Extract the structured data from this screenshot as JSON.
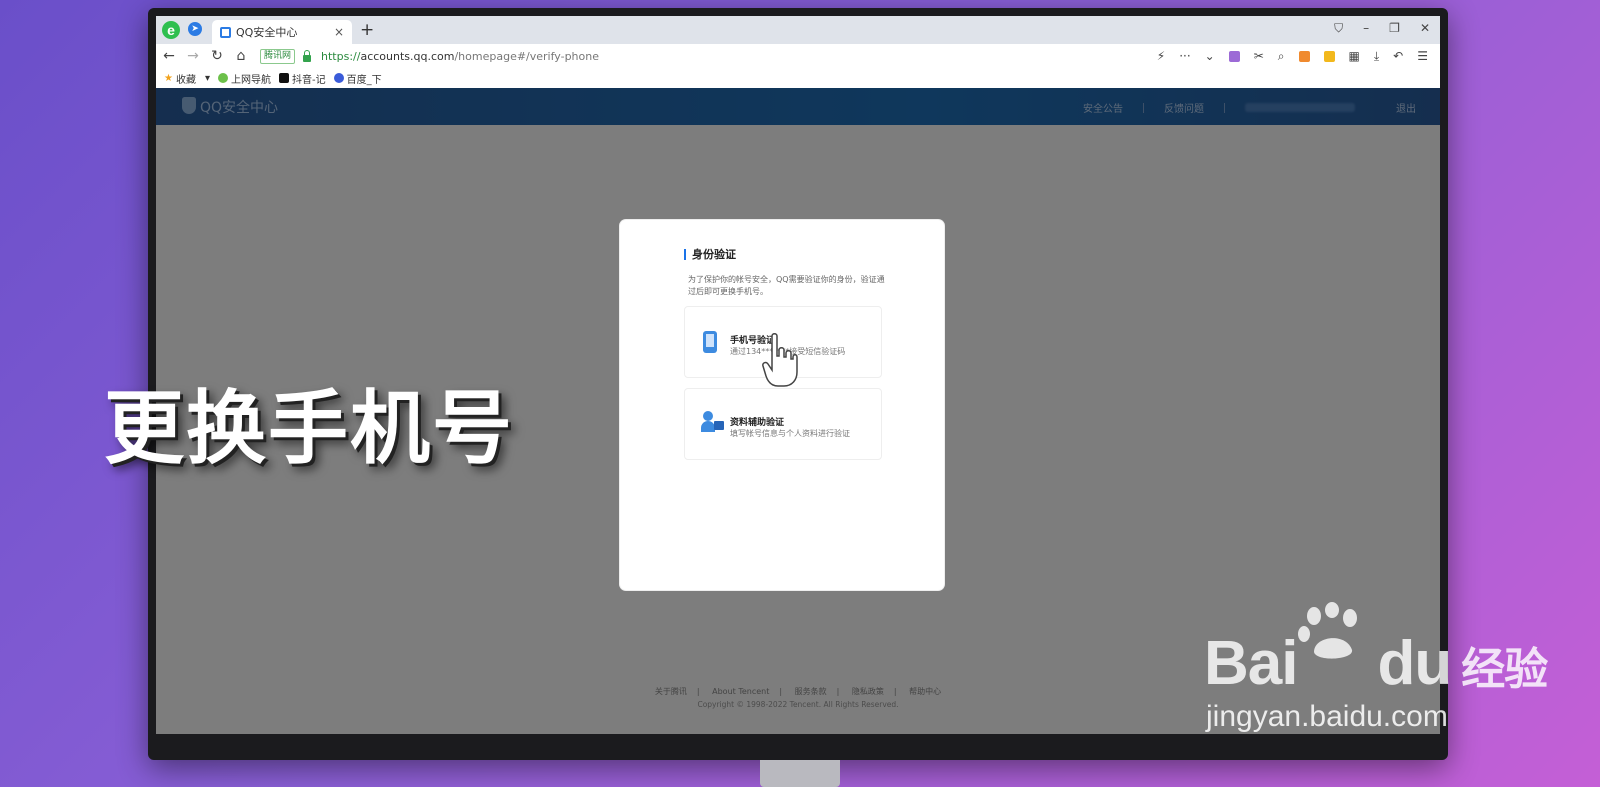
{
  "browser": {
    "logo_glyph": "e",
    "tab_title": "QQ安全中心",
    "tab_close": "×",
    "new_tab": "+",
    "url": {
      "badge": "腾讯网",
      "scheme": "https://",
      "host": "accounts.qq.com",
      "path": "/homepage#/verify-phone"
    },
    "bookmarks": [
      "收藏",
      "上网导航",
      "抖音-记",
      "百度_下"
    ]
  },
  "site": {
    "brand": "QQ安全中心",
    "nav": [
      "安全公告",
      "反馈问题",
      "退出"
    ]
  },
  "card": {
    "title": "身份验证",
    "description": "为了保护你的帐号安全，QQ需要验证你的身份，验证通过后即可更换手机号。",
    "options": [
      {
        "title": "手机号验证",
        "subtitle": "通过134*******接受短信验证码"
      },
      {
        "title": "资料辅助验证",
        "subtitle": "填写帐号信息与个人资料进行验证"
      }
    ]
  },
  "footer": {
    "links": [
      "关于腾讯",
      "About Tencent",
      "服务条款",
      "隐私政策",
      "帮助中心"
    ],
    "copyright": "Copyright © 1998-2022 Tencent. All Rights Reserved."
  },
  "caption": "更换手机号",
  "watermark": {
    "brand": "Bai",
    "brand2": "du",
    "cn": "经验",
    "url": "jingyan.baidu.com"
  },
  "colors": {
    "header": "#1e6fb8",
    "accent": "#3d8be0",
    "background": "#8a5fd6"
  }
}
